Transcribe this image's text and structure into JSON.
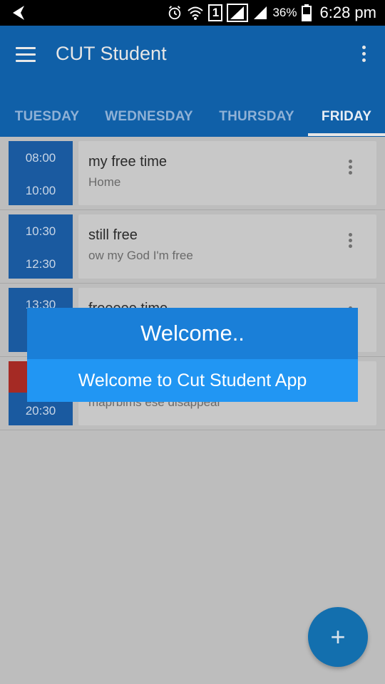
{
  "status_bar": {
    "battery_pct": "36%",
    "time": "6:28 pm",
    "sim_badge": "1"
  },
  "app_bar": {
    "title": "CUT Student",
    "tabs": [
      {
        "label": "TUESDAY",
        "active": false
      },
      {
        "label": "WEDNESDAY",
        "active": false
      },
      {
        "label": "THURSDAY",
        "active": false
      },
      {
        "label": "FRIDAY",
        "active": true
      }
    ]
  },
  "schedule": [
    {
      "start": "08:00",
      "end": "10:00",
      "title": "my free time",
      "subtitle": "Home"
    },
    {
      "start": "10:30",
      "end": "12:30",
      "title": "still free",
      "subtitle": "ow my God I'm free"
    },
    {
      "start": "13:30",
      "end": "",
      "title": "freeeee time",
      "subtitle": ""
    },
    {
      "start": "",
      "end": "20:30",
      "title": "",
      "subtitle": "maprbims ese disappear"
    }
  ],
  "dialog": {
    "title": "Welcome..",
    "message": "Welcome to Cut Student App"
  },
  "fab": {
    "label": "+"
  },
  "colors": {
    "primary": "#1060a8",
    "accent": "#2196f3",
    "time_block": "#1a5aa0",
    "flag": "#a52a24"
  }
}
